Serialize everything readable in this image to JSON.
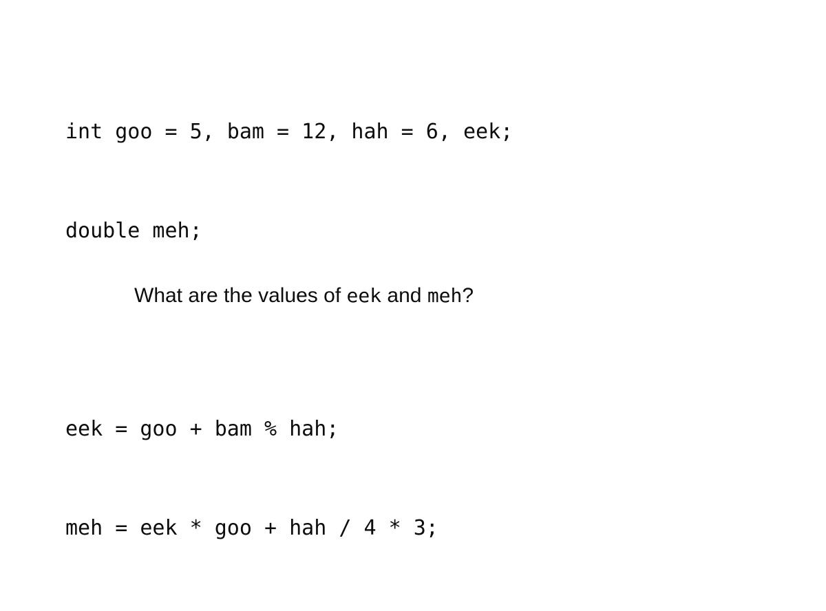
{
  "slide": {
    "background_color": "#ffffff",
    "text_color": "#0d0d0d"
  },
  "code_block": {
    "language": "c",
    "lines": [
      "int goo = 5, bam = 12, hah = 6, eek;",
      "double meh;",
      "",
      "eek = goo + bam % hah;",
      "meh = eek * goo + hah / 4 * 3;"
    ],
    "declarations": [
      {
        "type": "int",
        "name": "goo",
        "value": "5"
      },
      {
        "type": "int",
        "name": "bam",
        "value": "12"
      },
      {
        "type": "int",
        "name": "hah",
        "value": "6"
      },
      {
        "type": "int",
        "name": "eek",
        "value": ""
      },
      {
        "type": "double",
        "name": "meh",
        "value": ""
      }
    ],
    "assignments": [
      {
        "target": "eek",
        "expression": "goo + bam % hah"
      },
      {
        "target": "meh",
        "expression": "eek * goo + hah / 4 * 3"
      }
    ]
  },
  "question": {
    "prefix": "What are the values of ",
    "var_one": "eek",
    "conjunction": " and ",
    "var_two": "meh",
    "suffix": "?"
  }
}
